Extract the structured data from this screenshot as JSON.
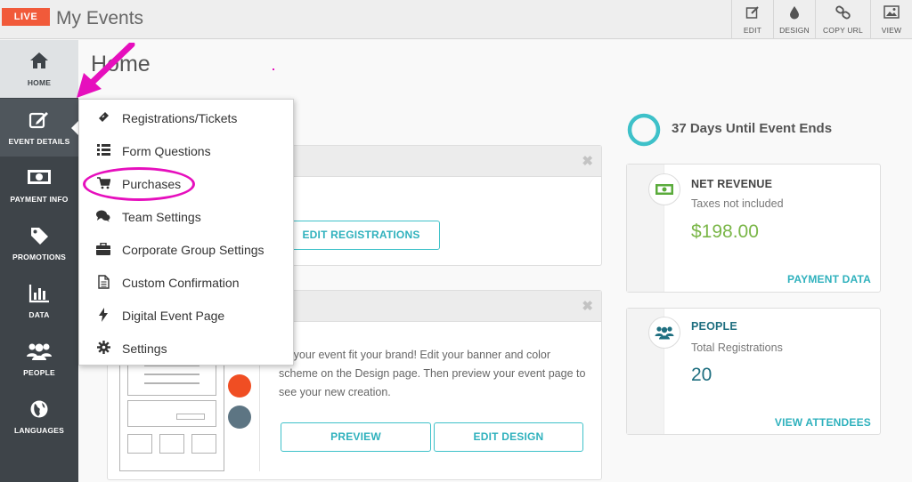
{
  "header": {
    "live_badge": "LIVE",
    "title": "My Events",
    "tools": [
      {
        "label": "EDIT",
        "icon": "edit-icon"
      },
      {
        "label": "DESIGN",
        "icon": "droplet-icon"
      },
      {
        "label": "COPY URL",
        "icon": "link-icon"
      },
      {
        "label": "VIEW",
        "icon": "image-icon"
      }
    ]
  },
  "sidebar": {
    "items": [
      {
        "label": "HOME",
        "icon": "home-icon"
      },
      {
        "label": "EVENT DETAILS",
        "icon": "pencil-square-icon"
      },
      {
        "label": "PAYMENT INFO",
        "icon": "money-icon"
      },
      {
        "label": "PROMOTIONS",
        "icon": "tag-icon"
      },
      {
        "label": "DATA",
        "icon": "bar-chart-icon"
      },
      {
        "label": "PEOPLE",
        "icon": "people-icon"
      },
      {
        "label": "LANGUAGES",
        "icon": "globe-icon"
      }
    ]
  },
  "dropdown": {
    "items": [
      {
        "label": "Registrations/Tickets",
        "icon": "ticket-icon"
      },
      {
        "label": "Form Questions",
        "icon": "list-icon"
      },
      {
        "label": "Purchases",
        "icon": "cart-icon"
      },
      {
        "label": "Team Settings",
        "icon": "comments-icon"
      },
      {
        "label": "Corporate Group Settings",
        "icon": "briefcase-icon"
      },
      {
        "label": "Custom Confirmation",
        "icon": "document-icon"
      },
      {
        "label": "Digital Event Page",
        "icon": "bolt-icon"
      },
      {
        "label": "Settings",
        "icon": "gear-icon"
      }
    ]
  },
  "main": {
    "title": "Home",
    "registrations_panel": {
      "button": "EDIT REGISTRATIONS"
    },
    "design_panel": {
      "text": "ke your event fit your brand! Edit your banner and color scheme on the Design page. Then preview your event page to see your new creation.",
      "preview_button": "PREVIEW",
      "edit_design_button": "EDIT DESIGN"
    },
    "countdown": "37 Days Until Event Ends",
    "revenue_card": {
      "title": "NET REVENUE",
      "subtitle": "Taxes not included",
      "value": "$198.00",
      "link": "PAYMENT DATA"
    },
    "people_card": {
      "title": "PEOPLE",
      "subtitle": "Total Registrations",
      "value": "20",
      "link": "VIEW ATTENDEES"
    }
  },
  "colors": {
    "accent": "#2fb1bd",
    "live": "#f15a3a",
    "sidebar": "#3e4449",
    "annotation": "#e60fbd",
    "revenue": "#7ab648",
    "people": "#1f6f80",
    "swatch_orange": "#f04e23",
    "swatch_slate": "#5d7583"
  }
}
